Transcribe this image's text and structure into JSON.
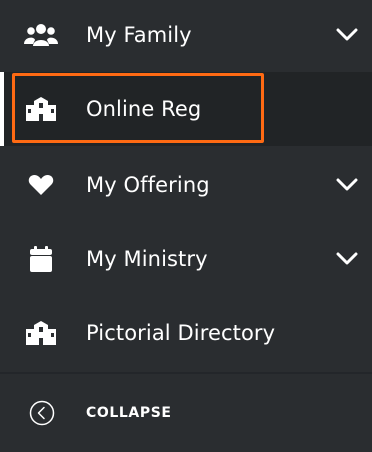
{
  "nav": {
    "items": [
      {
        "label": "My Family",
        "icon": "family-icon",
        "expandable": true
      },
      {
        "label": "Online Reg",
        "icon": "building-icon",
        "expandable": false,
        "active": true
      },
      {
        "label": "My Offering",
        "icon": "heart-icon",
        "expandable": true
      },
      {
        "label": "My Ministry",
        "icon": "calendar-icon",
        "expandable": true
      },
      {
        "label": "Pictorial Directory",
        "icon": "building-icon",
        "expandable": false
      }
    ],
    "collapse_label": "COLLAPSE"
  },
  "colors": {
    "background": "#2a2d30",
    "active_background": "#212426",
    "highlight": "#ff6a13",
    "text": "#ffffff"
  }
}
